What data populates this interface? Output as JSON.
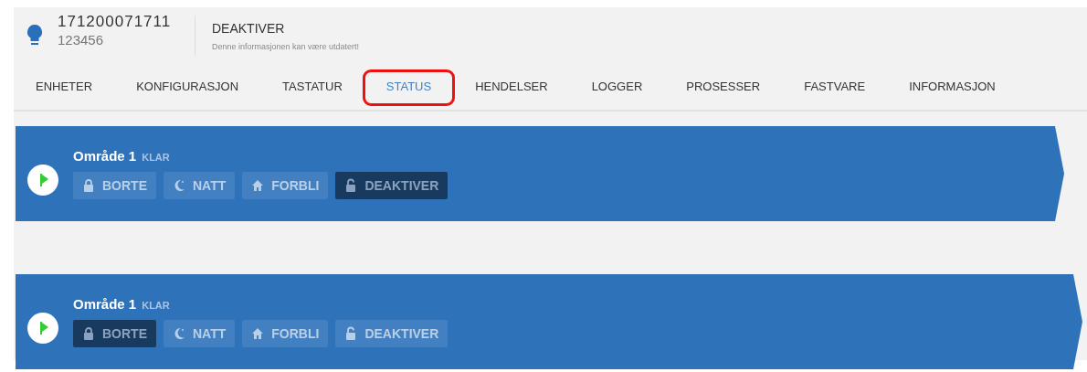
{
  "device": {
    "id": "171200071711",
    "code": "123456"
  },
  "status": {
    "state": "DEAKTIVER",
    "note": "Denne informasjonen kan være utdatert!"
  },
  "tabs": [
    {
      "label": "ENHETER",
      "selected": false,
      "highlighted": false
    },
    {
      "label": "KONFIGURASJON",
      "selected": false,
      "highlighted": false
    },
    {
      "label": "TASTATUR",
      "selected": false,
      "highlighted": false
    },
    {
      "label": "STATUS",
      "selected": true,
      "highlighted": true
    },
    {
      "label": "HENDELSER",
      "selected": false,
      "highlighted": false
    },
    {
      "label": "LOGGER",
      "selected": false,
      "highlighted": false
    },
    {
      "label": "PROSESSER",
      "selected": false,
      "highlighted": false
    },
    {
      "label": "FASTVARE",
      "selected": false,
      "highlighted": false
    },
    {
      "label": "INFORMASJON",
      "selected": false,
      "highlighted": false
    }
  ],
  "areas": [
    {
      "name": "Område 1",
      "state": "KLAR",
      "modes": [
        {
          "kind": "lock",
          "label": "BORTE",
          "selected": false
        },
        {
          "kind": "moon",
          "label": "NATT",
          "selected": false
        },
        {
          "kind": "home",
          "label": "FORBLI",
          "selected": false
        },
        {
          "kind": "unlock",
          "label": "DEAKTIVER",
          "selected": true
        }
      ]
    },
    {
      "name": "Område 1",
      "state": "KLAR",
      "modes": [
        {
          "kind": "lock",
          "label": "BORTE",
          "selected": true
        },
        {
          "kind": "moon",
          "label": "NATT",
          "selected": false
        },
        {
          "kind": "home",
          "label": "FORBLI",
          "selected": false
        },
        {
          "kind": "unlock",
          "label": "DEAKTIVER",
          "selected": false
        }
      ]
    }
  ]
}
